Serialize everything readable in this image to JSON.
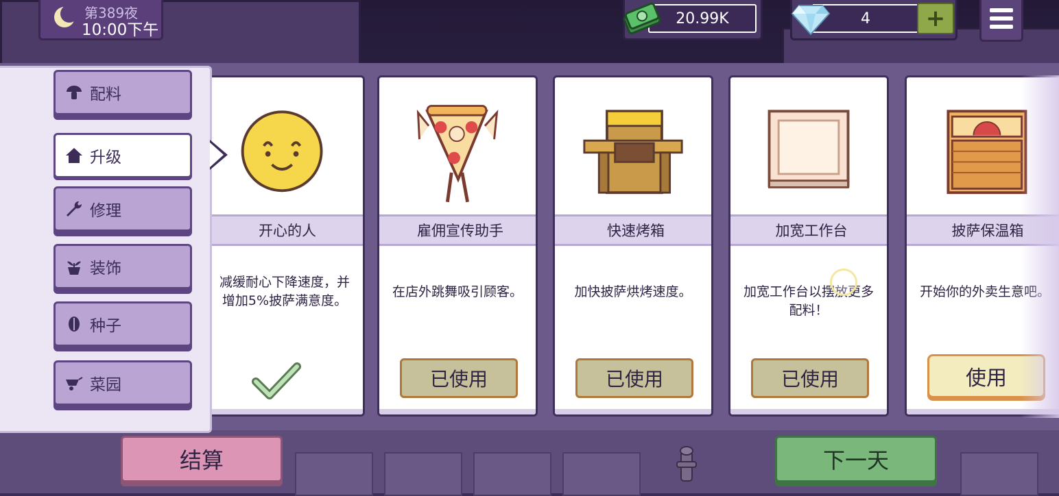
{
  "hud": {
    "day_label": "第389夜",
    "time_label": "10:00下午",
    "money": "20.99K",
    "gems": "4",
    "gem_add_label": "+"
  },
  "sidebar": {
    "items": [
      {
        "label": "配料",
        "icon": "mushroom-icon"
      },
      {
        "label": "升级",
        "icon": "home-icon"
      },
      {
        "label": "修理",
        "icon": "wrench-icon"
      },
      {
        "label": "装饰",
        "icon": "plant-pot-icon"
      },
      {
        "label": "种子",
        "icon": "seed-icon"
      },
      {
        "label": "菜园",
        "icon": "wheelbarrow-icon"
      }
    ],
    "active_index": 1
  },
  "cards": [
    {
      "title": "开心的人",
      "description": "减缓耐心下降速度，并增加5%披萨满意度。",
      "status": "check"
    },
    {
      "title": "雇佣宣传助手",
      "description": "在店外跳舞吸引顾客。",
      "button": "已使用"
    },
    {
      "title": "快速烤箱",
      "description": "加快披萨烘烤速度。",
      "button": "已使用"
    },
    {
      "title": "加宽工作台",
      "description": "加宽工作台以摆放更多配料！",
      "button": "已使用"
    },
    {
      "title": "披萨保温箱",
      "description": "开始你的外卖生意吧。",
      "button": "使用"
    }
  ],
  "bottom": {
    "settle_label": "结算",
    "next_day_label": "下一天"
  },
  "colors": {
    "panel": "#6c5a8a",
    "used_button": "#c6c19a",
    "use_button": "#f3ecbf",
    "settle_button": "#dc95b4",
    "next_button": "#79b77a"
  }
}
